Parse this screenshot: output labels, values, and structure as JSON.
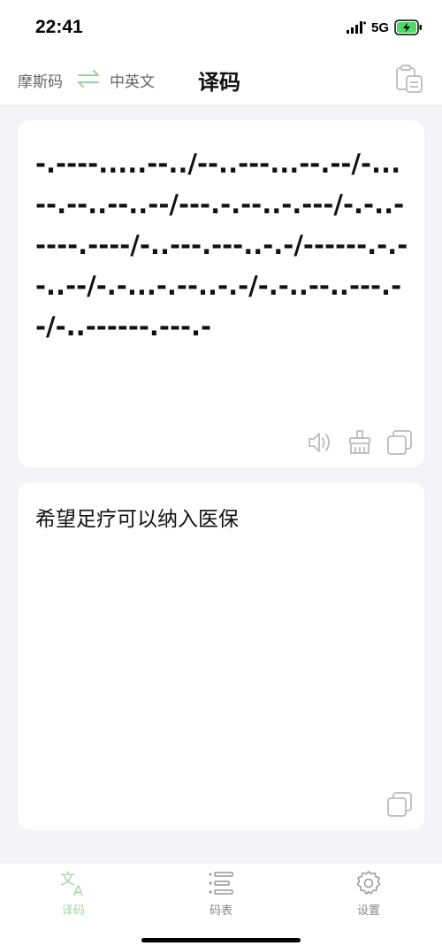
{
  "status_bar": {
    "time": "22:41",
    "network": "5G"
  },
  "header": {
    "source_language": "摩斯码",
    "target_language": "中英文",
    "title": "译码"
  },
  "input_card": {
    "morse_text": "-.----.....--../--..---...--.--/-...--.--..--..--/---.-.--..-.---/-.-..-----.----/-..---.---..-.-/------.-.--..--/-.-...-.--..-.-/-.-..--..---.--/-..------.---.-"
  },
  "output_card": {
    "result_text": "希望足疗可以纳入医保"
  },
  "tabs": [
    {
      "label": "译码",
      "icon": "translate-icon",
      "active": true
    },
    {
      "label": "码表",
      "icon": "code-table-icon",
      "active": false
    },
    {
      "label": "设置",
      "icon": "settings-gear-icon",
      "active": false
    }
  ],
  "colors": {
    "accent": "#a3d4a8",
    "inactive": "#888888",
    "background": "#f4f4f6"
  }
}
